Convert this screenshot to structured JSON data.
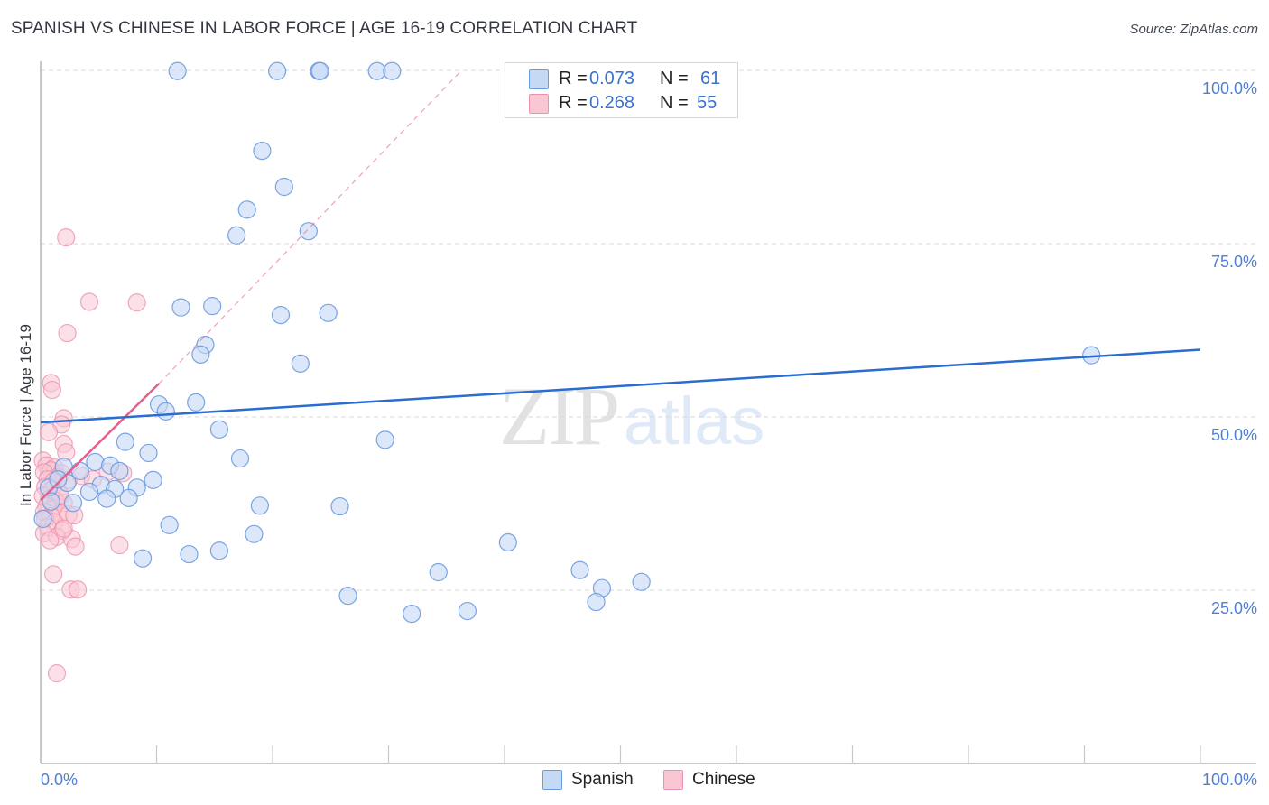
{
  "header": {
    "title": "SPANISH VS CHINESE IN LABOR FORCE | AGE 16-19 CORRELATION CHART",
    "source": "Source: ZipAtlas.com"
  },
  "legend": {
    "rows": [
      {
        "series": "Spanish",
        "r_label": "R =",
        "r_value": "0.073",
        "n_label": "N =",
        "n_value": "61"
      },
      {
        "series": "Chinese",
        "r_label": "R =",
        "r_value": "0.268",
        "n_label": "N =",
        "n_value": "55"
      }
    ]
  },
  "bottom_legend": [
    {
      "label": "Spanish"
    },
    {
      "label": "Chinese"
    }
  ],
  "watermark": {
    "zip": "ZIP",
    "atlas": "atlas"
  },
  "colors": {
    "spanish_fill": "#c5d9f5",
    "spanish_stroke": "#6a9be0",
    "spanish_line": "#2a6dd0",
    "chinese_fill": "#f9c6d4",
    "chinese_stroke": "#ec92ae",
    "chinese_line": "#e5608a",
    "tick_text": "#4f7fd1"
  },
  "chart_data": {
    "type": "scatter",
    "title": "SPANISH VS CHINESE IN LABOR FORCE | AGE 16-19 CORRELATION CHART",
    "xlabel": "",
    "ylabel": "In Labor Force | Age 16-19",
    "xlim": [
      0,
      100
    ],
    "ylim": [
      0,
      100
    ],
    "x_tick_labels": [
      {
        "value": 0,
        "label": "0.0%"
      },
      {
        "value": 100,
        "label": "100.0%"
      }
    ],
    "x_minor_ticks": [
      10,
      20,
      30,
      40,
      50,
      60,
      70,
      80,
      90,
      100
    ],
    "y_tick_labels": [
      {
        "value": 100,
        "label": "100.0%"
      },
      {
        "value": 75,
        "label": "75.0%"
      },
      {
        "value": 50,
        "label": "50.0%"
      },
      {
        "value": 25,
        "label": "25.0%"
      }
    ],
    "grid": "horizontal dashed",
    "legend_position": "top-center",
    "series": [
      {
        "name": "Spanish",
        "r": 0.073,
        "n": 61,
        "trend": {
          "x": [
            0,
            100
          ],
          "y": [
            49.2,
            59.7
          ],
          "style": "solid"
        },
        "points": [
          [
            11.8,
            99.9
          ],
          [
            20.4,
            99.9
          ],
          [
            24.0,
            99.9
          ],
          [
            24.1,
            99.9
          ],
          [
            29.0,
            99.9
          ],
          [
            30.3,
            99.9
          ],
          [
            19.1,
            88.4
          ],
          [
            21.0,
            83.2
          ],
          [
            17.8,
            79.9
          ],
          [
            16.9,
            76.2
          ],
          [
            23.1,
            76.8
          ],
          [
            12.1,
            65.8
          ],
          [
            14.8,
            66.0
          ],
          [
            20.7,
            64.7
          ],
          [
            24.8,
            65.0
          ],
          [
            14.2,
            60.4
          ],
          [
            13.8,
            59.0
          ],
          [
            22.4,
            57.7
          ],
          [
            90.6,
            58.9
          ],
          [
            10.2,
            51.8
          ],
          [
            10.8,
            50.8
          ],
          [
            13.4,
            52.1
          ],
          [
            15.4,
            48.2
          ],
          [
            29.7,
            46.7
          ],
          [
            7.3,
            46.4
          ],
          [
            9.3,
            44.8
          ],
          [
            17.2,
            44.0
          ],
          [
            4.7,
            43.5
          ],
          [
            6.0,
            43.0
          ],
          [
            2.0,
            42.8
          ],
          [
            3.4,
            42.2
          ],
          [
            6.8,
            42.2
          ],
          [
            0.7,
            39.8
          ],
          [
            2.3,
            40.5
          ],
          [
            5.2,
            40.2
          ],
          [
            9.7,
            40.9
          ],
          [
            4.2,
            39.2
          ],
          [
            6.4,
            39.6
          ],
          [
            8.3,
            39.8
          ],
          [
            5.7,
            38.2
          ],
          [
            7.6,
            38.3
          ],
          [
            2.8,
            37.6
          ],
          [
            18.9,
            37.2
          ],
          [
            25.8,
            37.1
          ],
          [
            11.1,
            34.4
          ],
          [
            15.4,
            30.7
          ],
          [
            18.4,
            33.1
          ],
          [
            40.3,
            31.9
          ],
          [
            8.8,
            29.6
          ],
          [
            12.8,
            30.2
          ],
          [
            34.3,
            27.6
          ],
          [
            46.5,
            27.9
          ],
          [
            51.8,
            26.2
          ],
          [
            48.4,
            25.3
          ],
          [
            26.5,
            24.2
          ],
          [
            47.9,
            23.3
          ],
          [
            32.0,
            21.6
          ],
          [
            36.8,
            22.0
          ],
          [
            0.9,
            37.8
          ],
          [
            0.2,
            35.3
          ],
          [
            1.5,
            41.0
          ]
        ]
      },
      {
        "name": "Chinese",
        "r": 0.268,
        "n": 55,
        "trend": {
          "x": [
            0,
            10.2
          ],
          "y": [
            38.0,
            54.8
          ],
          "style": "solid",
          "extended": {
            "x": [
              10.2,
              36.3
            ],
            "y": [
              54.8,
              100
            ],
            "style": "dashed"
          }
        },
        "points": [
          [
            2.2,
            75.9
          ],
          [
            4.2,
            66.6
          ],
          [
            8.3,
            66.5
          ],
          [
            2.3,
            62.1
          ],
          [
            0.9,
            54.9
          ],
          [
            1.0,
            53.9
          ],
          [
            2.0,
            49.8
          ],
          [
            1.8,
            48.9
          ],
          [
            0.7,
            47.8
          ],
          [
            2.0,
            46.1
          ],
          [
            2.2,
            44.9
          ],
          [
            0.2,
            43.7
          ],
          [
            0.5,
            43.0
          ],
          [
            1.2,
            42.7
          ],
          [
            0.9,
            42.3
          ],
          [
            0.3,
            42.0
          ],
          [
            1.8,
            41.9
          ],
          [
            1.5,
            41.3
          ],
          [
            0.6,
            41.0
          ],
          [
            1.1,
            40.7
          ],
          [
            2.4,
            40.9
          ],
          [
            5.8,
            42.1
          ],
          [
            7.1,
            41.9
          ],
          [
            3.5,
            41.5
          ],
          [
            4.5,
            41.0
          ],
          [
            0.4,
            39.9
          ],
          [
            1.0,
            39.5
          ],
          [
            1.6,
            39.0
          ],
          [
            0.2,
            38.6
          ],
          [
            0.8,
            38.2
          ],
          [
            1.3,
            37.9
          ],
          [
            2.0,
            37.6
          ],
          [
            0.5,
            37.1
          ],
          [
            1.1,
            36.8
          ],
          [
            0.3,
            36.3
          ],
          [
            1.7,
            36.1
          ],
          [
            0.9,
            35.7
          ],
          [
            2.4,
            35.9
          ],
          [
            0.4,
            35.3
          ],
          [
            1.2,
            34.8
          ],
          [
            0.6,
            34.1
          ],
          [
            1.9,
            33.6
          ],
          [
            0.3,
            33.2
          ],
          [
            1.4,
            32.7
          ],
          [
            0.8,
            32.2
          ],
          [
            2.7,
            32.4
          ],
          [
            2.0,
            33.9
          ],
          [
            3.0,
            31.3
          ],
          [
            6.8,
            31.5
          ],
          [
            1.1,
            27.3
          ],
          [
            2.6,
            25.1
          ],
          [
            3.2,
            25.1
          ],
          [
            1.4,
            13.0
          ],
          [
            1.7,
            38.7
          ],
          [
            2.9,
            35.8
          ]
        ]
      }
    ]
  }
}
